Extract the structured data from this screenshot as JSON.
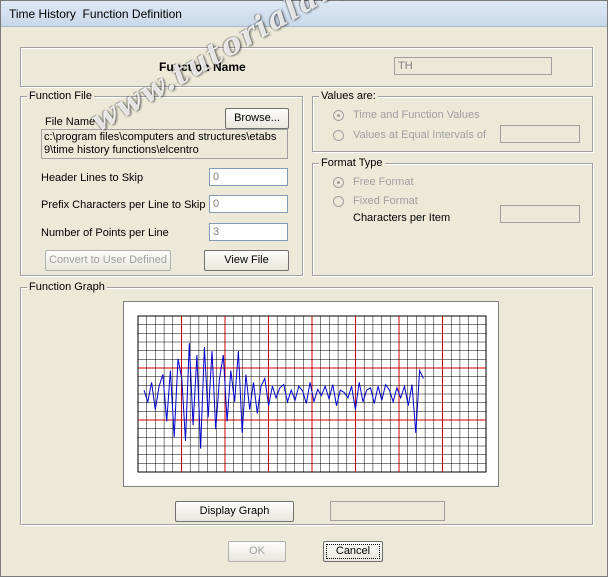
{
  "window": {
    "title": "Time History  Function Definition"
  },
  "function_name": {
    "label": "Function Name",
    "value": "TH"
  },
  "function_file": {
    "legend": "Function File",
    "file_name_label": "File Name",
    "browse_label": "Browse...",
    "path_line1": "c:\\program files\\computers and structures\\etabs",
    "path_line2": "9\\time history functions\\elcentro",
    "header_lines_label": "Header Lines to Skip",
    "header_lines_value": "0",
    "prefix_chars_label": "Prefix Characters per Line to Skip",
    "prefix_chars_value": "0",
    "points_per_line_label": "Number of Points per Line",
    "points_per_line_value": "3",
    "convert_label": "Convert to User Defined",
    "view_file_label": "View File"
  },
  "values_are": {
    "legend": "Values are:",
    "option1": "Time and Function Values",
    "option2": "Values at Equal Intervals of",
    "selected": "option1"
  },
  "format_type": {
    "legend": "Format Type",
    "option1": "Free Format",
    "option2": "Fixed Format",
    "chars_per_item_label": "Characters per Item",
    "selected": "option1"
  },
  "function_graph": {
    "legend": "Function Graph",
    "display_graph_label": "Display Graph"
  },
  "footer": {
    "ok_label": "OK",
    "cancel_label": "Cancel"
  },
  "watermark": {
    "text": "www.tutorialargajogja.co.nr"
  },
  "colors": {
    "grid_minor": "#000000",
    "grid_major": "#cc0000",
    "trace": "#0000cc"
  },
  "chart_data": {
    "type": "line",
    "title": "",
    "xlabel": "",
    "ylabel": "",
    "xlim": [
      0,
      1
    ],
    "ylim": [
      -1,
      1
    ],
    "series": [
      {
        "values": [
          0.05,
          -0.1,
          0.15,
          -0.2,
          0.1,
          0.25,
          -0.35,
          0.3,
          -0.55,
          0.45,
          0.2,
          -0.6,
          0.65,
          -0.4,
          0.5,
          -0.7,
          0.6,
          -0.3,
          0.55,
          -0.45,
          0.2,
          0.5,
          -0.35,
          0.3,
          -0.1,
          0.55,
          -0.5,
          0.25,
          -0.2,
          0.15,
          -0.25,
          0.1,
          0.2,
          -0.15,
          0.1,
          -0.05,
          0.08,
          0.12,
          -0.1,
          0.05,
          -0.08,
          0.1,
          0.04,
          -0.12,
          0.15,
          -0.1,
          0.06,
          -0.02,
          0.1,
          -0.06,
          0.12,
          -0.15,
          0.05,
          0.02,
          -0.05,
          0.1,
          -0.2,
          0.15,
          -0.1,
          0.05,
          0.08,
          -0.12,
          0.1,
          -0.08,
          0.12,
          0.05,
          -0.1,
          0.08,
          -0.05,
          0.1,
          -0.15,
          0.12,
          -0.5,
          0.3,
          0.2
        ]
      }
    ]
  }
}
